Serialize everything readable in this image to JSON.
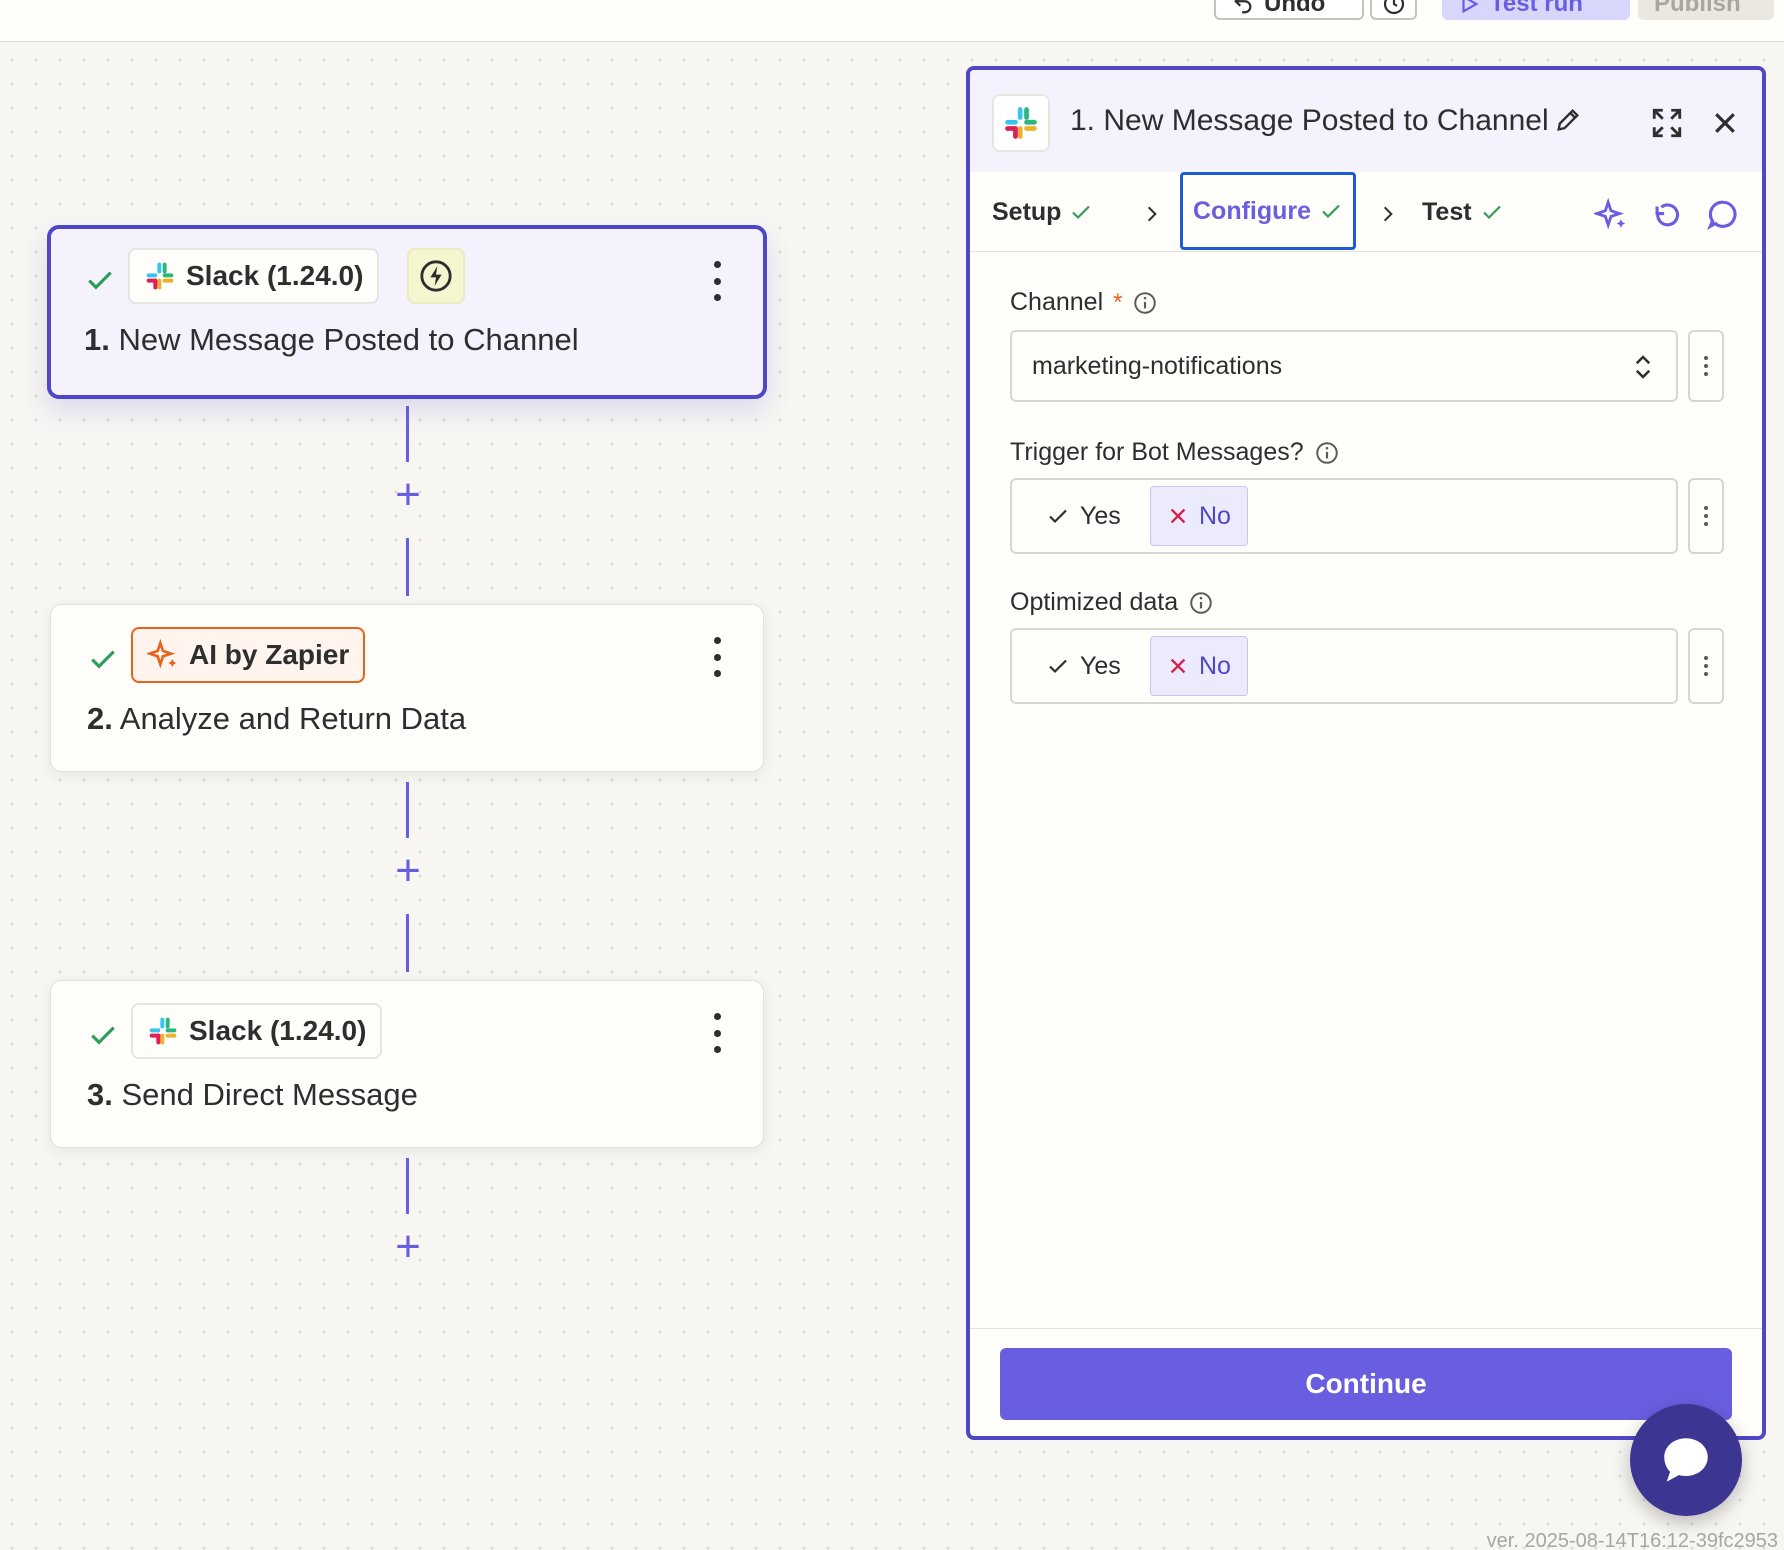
{
  "topbar": {
    "undo_label": "Undo",
    "test_run_label": "Test run",
    "publish_label": "Publish"
  },
  "canvas": {
    "nodes": [
      {
        "app": "Slack (1.24.0)",
        "number": "1.",
        "title": "New Message Posted to Channel",
        "status": "complete",
        "trigger_badge": "bolt-icon"
      },
      {
        "app": "AI by Zapier",
        "number": "2.",
        "title": "Analyze and Return Data",
        "status": "complete"
      },
      {
        "app": "Slack (1.24.0)",
        "number": "3.",
        "title": "Send Direct Message",
        "status": "complete"
      }
    ]
  },
  "panel": {
    "title": "1. New Message Posted to Channel",
    "tabs": [
      {
        "label": "Setup",
        "done": true
      },
      {
        "label": "Configure",
        "done": true,
        "active": true
      },
      {
        "label": "Test",
        "done": true
      }
    ],
    "fields": {
      "channel": {
        "label": "Channel",
        "required_mark": "*",
        "value": "marketing-notifications"
      },
      "bot_messages": {
        "label": "Trigger for Bot Messages?",
        "yes_label": "Yes",
        "no_label": "No",
        "selected": "No"
      },
      "optimized_data": {
        "label": "Optimized data",
        "yes_label": "Yes",
        "no_label": "No",
        "selected": "No"
      }
    },
    "continue_label": "Continue"
  },
  "version": "ver. 2025-08-14T16:12-39fc2953",
  "colors": {
    "accent": "#6a5ee0",
    "selected_border": "#5046c8",
    "success": "#2e9e5b",
    "ai_orange": "#e8641c",
    "chat_button": "#3c3592"
  }
}
